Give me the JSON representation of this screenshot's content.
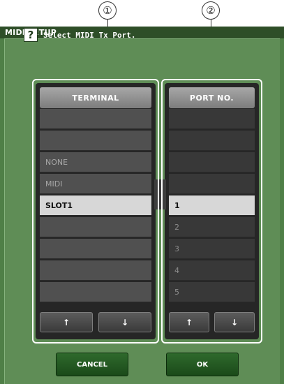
{
  "callouts": [
    "①",
    "②"
  ],
  "window": {
    "title": "MIDI SETUP"
  },
  "prompt": {
    "icon": "?",
    "text": "Select MIDI Tx Port."
  },
  "terminal": {
    "header": "TERMINAL",
    "rows": [
      "",
      "",
      "NONE",
      "MIDI",
      "SLOT1",
      "",
      "",
      "",
      ""
    ],
    "selected_index": 4,
    "up": "↑",
    "down": "↓"
  },
  "port": {
    "header": "PORT NO.",
    "rows": [
      "",
      "",
      "",
      "",
      "1",
      "2",
      "3",
      "4",
      "5"
    ],
    "selected_index": 4,
    "up": "↑",
    "down": "↓"
  },
  "buttons": {
    "cancel": "CANCEL",
    "ok": "OK"
  },
  "colors": {
    "window_bg": "#5f8d56",
    "title_bar": "#2e4e28",
    "selected_row": "#d7d7d7",
    "button_green": "#2f6a2c"
  }
}
